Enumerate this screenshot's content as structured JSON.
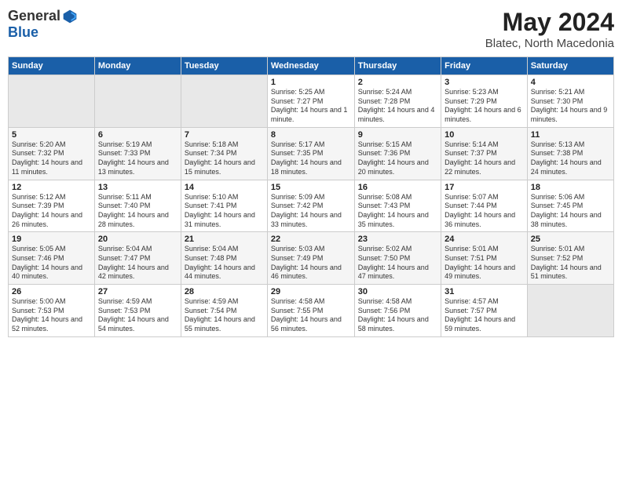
{
  "logo": {
    "general": "General",
    "blue": "Blue"
  },
  "title": {
    "month": "May 2024",
    "location": "Blatec, North Macedonia"
  },
  "days_header": [
    "Sunday",
    "Monday",
    "Tuesday",
    "Wednesday",
    "Thursday",
    "Friday",
    "Saturday"
  ],
  "weeks": [
    [
      {
        "day": "",
        "sunrise": "",
        "sunset": "",
        "daylight": ""
      },
      {
        "day": "",
        "sunrise": "",
        "sunset": "",
        "daylight": ""
      },
      {
        "day": "",
        "sunrise": "",
        "sunset": "",
        "daylight": ""
      },
      {
        "day": "1",
        "sunrise": "Sunrise: 5:25 AM",
        "sunset": "Sunset: 7:27 PM",
        "daylight": "Daylight: 14 hours and 1 minute."
      },
      {
        "day": "2",
        "sunrise": "Sunrise: 5:24 AM",
        "sunset": "Sunset: 7:28 PM",
        "daylight": "Daylight: 14 hours and 4 minutes."
      },
      {
        "day": "3",
        "sunrise": "Sunrise: 5:23 AM",
        "sunset": "Sunset: 7:29 PM",
        "daylight": "Daylight: 14 hours and 6 minutes."
      },
      {
        "day": "4",
        "sunrise": "Sunrise: 5:21 AM",
        "sunset": "Sunset: 7:30 PM",
        "daylight": "Daylight: 14 hours and 9 minutes."
      }
    ],
    [
      {
        "day": "5",
        "sunrise": "Sunrise: 5:20 AM",
        "sunset": "Sunset: 7:32 PM",
        "daylight": "Daylight: 14 hours and 11 minutes."
      },
      {
        "day": "6",
        "sunrise": "Sunrise: 5:19 AM",
        "sunset": "Sunset: 7:33 PM",
        "daylight": "Daylight: 14 hours and 13 minutes."
      },
      {
        "day": "7",
        "sunrise": "Sunrise: 5:18 AM",
        "sunset": "Sunset: 7:34 PM",
        "daylight": "Daylight: 14 hours and 15 minutes."
      },
      {
        "day": "8",
        "sunrise": "Sunrise: 5:17 AM",
        "sunset": "Sunset: 7:35 PM",
        "daylight": "Daylight: 14 hours and 18 minutes."
      },
      {
        "day": "9",
        "sunrise": "Sunrise: 5:15 AM",
        "sunset": "Sunset: 7:36 PM",
        "daylight": "Daylight: 14 hours and 20 minutes."
      },
      {
        "day": "10",
        "sunrise": "Sunrise: 5:14 AM",
        "sunset": "Sunset: 7:37 PM",
        "daylight": "Daylight: 14 hours and 22 minutes."
      },
      {
        "day": "11",
        "sunrise": "Sunrise: 5:13 AM",
        "sunset": "Sunset: 7:38 PM",
        "daylight": "Daylight: 14 hours and 24 minutes."
      }
    ],
    [
      {
        "day": "12",
        "sunrise": "Sunrise: 5:12 AM",
        "sunset": "Sunset: 7:39 PM",
        "daylight": "Daylight: 14 hours and 26 minutes."
      },
      {
        "day": "13",
        "sunrise": "Sunrise: 5:11 AM",
        "sunset": "Sunset: 7:40 PM",
        "daylight": "Daylight: 14 hours and 28 minutes."
      },
      {
        "day": "14",
        "sunrise": "Sunrise: 5:10 AM",
        "sunset": "Sunset: 7:41 PM",
        "daylight": "Daylight: 14 hours and 31 minutes."
      },
      {
        "day": "15",
        "sunrise": "Sunrise: 5:09 AM",
        "sunset": "Sunset: 7:42 PM",
        "daylight": "Daylight: 14 hours and 33 minutes."
      },
      {
        "day": "16",
        "sunrise": "Sunrise: 5:08 AM",
        "sunset": "Sunset: 7:43 PM",
        "daylight": "Daylight: 14 hours and 35 minutes."
      },
      {
        "day": "17",
        "sunrise": "Sunrise: 5:07 AM",
        "sunset": "Sunset: 7:44 PM",
        "daylight": "Daylight: 14 hours and 36 minutes."
      },
      {
        "day": "18",
        "sunrise": "Sunrise: 5:06 AM",
        "sunset": "Sunset: 7:45 PM",
        "daylight": "Daylight: 14 hours and 38 minutes."
      }
    ],
    [
      {
        "day": "19",
        "sunrise": "Sunrise: 5:05 AM",
        "sunset": "Sunset: 7:46 PM",
        "daylight": "Daylight: 14 hours and 40 minutes."
      },
      {
        "day": "20",
        "sunrise": "Sunrise: 5:04 AM",
        "sunset": "Sunset: 7:47 PM",
        "daylight": "Daylight: 14 hours and 42 minutes."
      },
      {
        "day": "21",
        "sunrise": "Sunrise: 5:04 AM",
        "sunset": "Sunset: 7:48 PM",
        "daylight": "Daylight: 14 hours and 44 minutes."
      },
      {
        "day": "22",
        "sunrise": "Sunrise: 5:03 AM",
        "sunset": "Sunset: 7:49 PM",
        "daylight": "Daylight: 14 hours and 46 minutes."
      },
      {
        "day": "23",
        "sunrise": "Sunrise: 5:02 AM",
        "sunset": "Sunset: 7:50 PM",
        "daylight": "Daylight: 14 hours and 47 minutes."
      },
      {
        "day": "24",
        "sunrise": "Sunrise: 5:01 AM",
        "sunset": "Sunset: 7:51 PM",
        "daylight": "Daylight: 14 hours and 49 minutes."
      },
      {
        "day": "25",
        "sunrise": "Sunrise: 5:01 AM",
        "sunset": "Sunset: 7:52 PM",
        "daylight": "Daylight: 14 hours and 51 minutes."
      }
    ],
    [
      {
        "day": "26",
        "sunrise": "Sunrise: 5:00 AM",
        "sunset": "Sunset: 7:53 PM",
        "daylight": "Daylight: 14 hours and 52 minutes."
      },
      {
        "day": "27",
        "sunrise": "Sunrise: 4:59 AM",
        "sunset": "Sunset: 7:53 PM",
        "daylight": "Daylight: 14 hours and 54 minutes."
      },
      {
        "day": "28",
        "sunrise": "Sunrise: 4:59 AM",
        "sunset": "Sunset: 7:54 PM",
        "daylight": "Daylight: 14 hours and 55 minutes."
      },
      {
        "day": "29",
        "sunrise": "Sunrise: 4:58 AM",
        "sunset": "Sunset: 7:55 PM",
        "daylight": "Daylight: 14 hours and 56 minutes."
      },
      {
        "day": "30",
        "sunrise": "Sunrise: 4:58 AM",
        "sunset": "Sunset: 7:56 PM",
        "daylight": "Daylight: 14 hours and 58 minutes."
      },
      {
        "day": "31",
        "sunrise": "Sunrise: 4:57 AM",
        "sunset": "Sunset: 7:57 PM",
        "daylight": "Daylight: 14 hours and 59 minutes."
      },
      {
        "day": "",
        "sunrise": "",
        "sunset": "",
        "daylight": ""
      }
    ]
  ]
}
